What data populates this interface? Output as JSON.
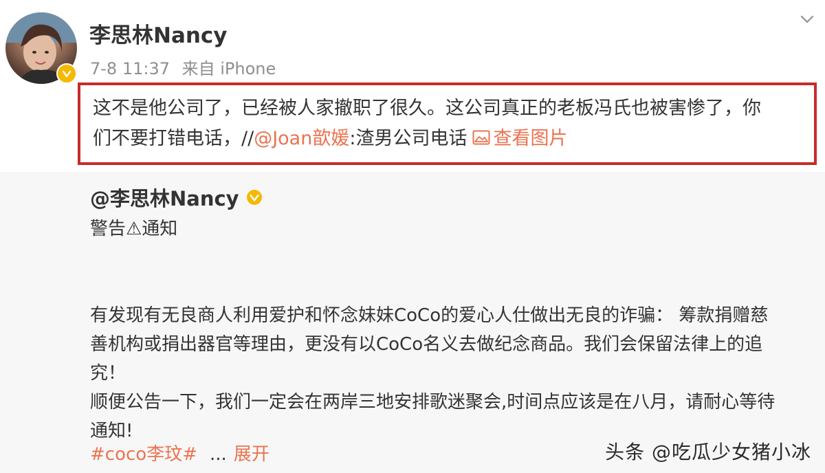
{
  "post": {
    "author": "李思林Nancy",
    "timestamp": "7-8 11:37",
    "source": "来自 iPhone",
    "text_line1": "这不是他公司了，已经被人家撤职了很久。这公司真正的老板冯氏也被害惨了，你",
    "text_line2_prefix": "们不要打错电话，//",
    "mention": "@Joan歆媛",
    "text_line2_suffix": ":渣男公司电话",
    "view_image_label": "查看图片"
  },
  "repost": {
    "author": "@李思林Nancy",
    "title": "警告⚠通知",
    "paragraph1_line1": "有发现有无良商人利用爱护和怀念妹妹CoCo的爱心人仕做出无良的诈骗： 筹款捐赠慈",
    "paragraph1_line2": "善机构或捐出器官等理由，更没有以CoCo名义去做纪念商品。我们会保留法律上的追",
    "paragraph1_line3": "究！",
    "paragraph2_line1": "顺便公告一下，我们一定会在两岸三地安排歌迷聚会,时间点应该是在八月，请耐心等待",
    "paragraph2_line2": "通知!",
    "hashtag": "#coco李玟#",
    "ellipsis": "...",
    "expand_label": "展开"
  },
  "watermark": "头条 @吃瓜少女猪小冰",
  "icons": {
    "menu": "chevron-down-icon",
    "verified": "verified-badge-icon",
    "image": "image-icon"
  },
  "colors": {
    "highlight_border": "#c92a2a",
    "link": "#eb7350",
    "verified": "#f6b800",
    "repost_background": "#f7f7f7"
  }
}
